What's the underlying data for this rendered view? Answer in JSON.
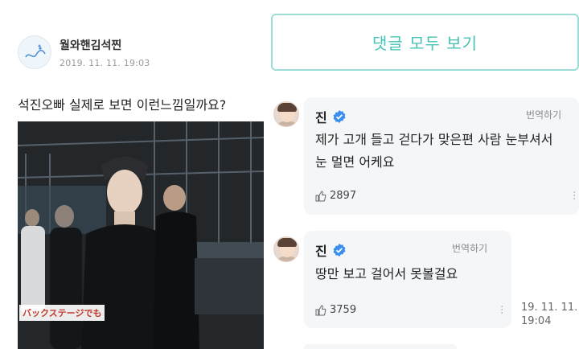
{
  "post": {
    "author": "월와핸김석찐",
    "date": "2019. 11. 11. 19:03",
    "body": "석진오빠 실제로 보면 이런느낌일까요?",
    "photo_caption": "バックステージでも"
  },
  "comments_link": {
    "label": "댓글 모두 보기"
  },
  "comments": [
    {
      "name": "진",
      "translate_label": "번역하기",
      "text_lines": [
        "제가 고개 들고 걷다가 맞은편 사람 눈부셔서",
        "눈 멀면 어케요"
      ],
      "likes": "2897"
    },
    {
      "name": "진",
      "translate_label": "번역하기",
      "text_lines": [
        "땅만 보고 걸어서 못볼걸요"
      ],
      "likes": "3759",
      "timestamp_lines": [
        "19. 11. 11.",
        "19:04"
      ]
    }
  ],
  "colors": {
    "accent": "#46c3b3",
    "verified": "#3a8ef0",
    "bubble": "#f4f6f8"
  },
  "icons": [
    "verified-badge-icon",
    "thumbs-up-icon",
    "more-options-icon"
  ]
}
